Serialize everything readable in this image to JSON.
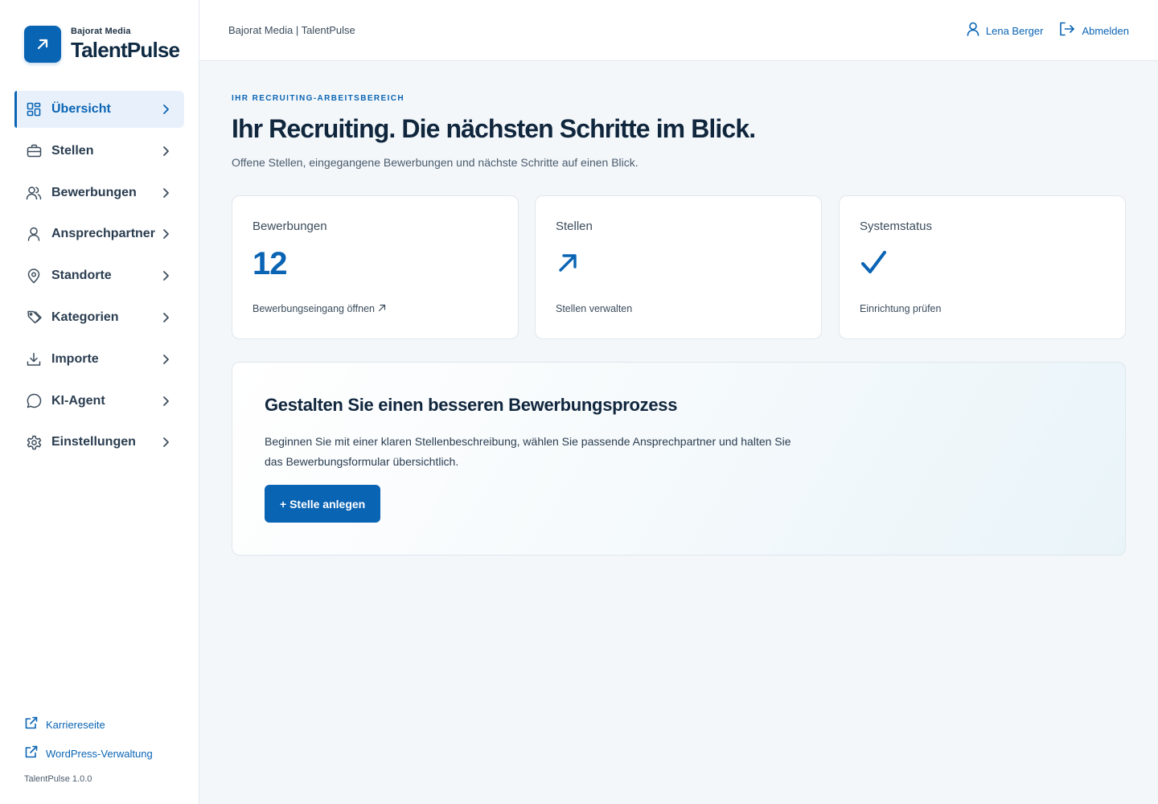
{
  "brand": {
    "company": "Bajorat Media",
    "product": "TalentPulse",
    "logo_icon": "arrow-up-right-icon"
  },
  "nav": {
    "items": [
      {
        "label": "Übersicht",
        "icon": "dashboard-grid-icon",
        "active": true
      },
      {
        "label": "Stellen",
        "icon": "briefcase-icon",
        "active": false
      },
      {
        "label": "Bewerbungen",
        "icon": "users-icon",
        "active": false
      },
      {
        "label": "Ansprechpartner",
        "icon": "user-icon",
        "active": false
      },
      {
        "label": "Standorte",
        "icon": "map-pin-icon",
        "active": false
      },
      {
        "label": "Kategorien",
        "icon": "tags-icon",
        "active": false
      },
      {
        "label": "Importe",
        "icon": "download-icon",
        "active": false
      },
      {
        "label": "KI-Agent",
        "icon": "chat-bubble-icon",
        "active": false
      },
      {
        "label": "Einstellungen",
        "icon": "gear-icon",
        "active": false
      }
    ]
  },
  "side_links": [
    {
      "label": "Karriereseite",
      "icon": "external-link-icon"
    },
    {
      "label": "WordPress-Verwaltung",
      "icon": "external-link-icon"
    }
  ],
  "version": "TalentPulse 1.0.0",
  "topbar": {
    "breadcrumb": "Bajorat Media | TalentPulse",
    "user_name": "Lena Berger",
    "logout_label": "Abmelden"
  },
  "hero": {
    "eyebrow": "IHR RECRUITING-ARBEITSBEREICH",
    "title": "Ihr Recruiting. Die nächsten Schritte im Blick.",
    "subtitle": "Offene Stellen, eingegangene Bewerbungen und nächste Schritte auf einen Blick."
  },
  "cards": [
    {
      "label": "Bewerbungen",
      "value": "12",
      "link": "Bewerbungseingang öffnen"
    },
    {
      "label": "Stellen",
      "icon": "arrow-up-right-icon",
      "link": "Stellen verwalten"
    },
    {
      "label": "Systemstatus",
      "icon": "checkmark-icon",
      "link": "Einrichtung prüfen"
    }
  ],
  "promo": {
    "title": "Gestalten Sie einen besseren Bewerbungsprozess",
    "text": "Beginnen Sie mit einer klaren Stellenbeschreibung, wählen Sie passende Ansprechpartner und halten Sie das Bewerbungsformular übersichtlich.",
    "button_label": "+ Stelle anlegen"
  },
  "colors": {
    "accent": "#0a64b4",
    "background": "#f3f7fa",
    "text": "#10263d",
    "muted": "#4a5b6c",
    "active_bg": "#e8f1fb"
  }
}
